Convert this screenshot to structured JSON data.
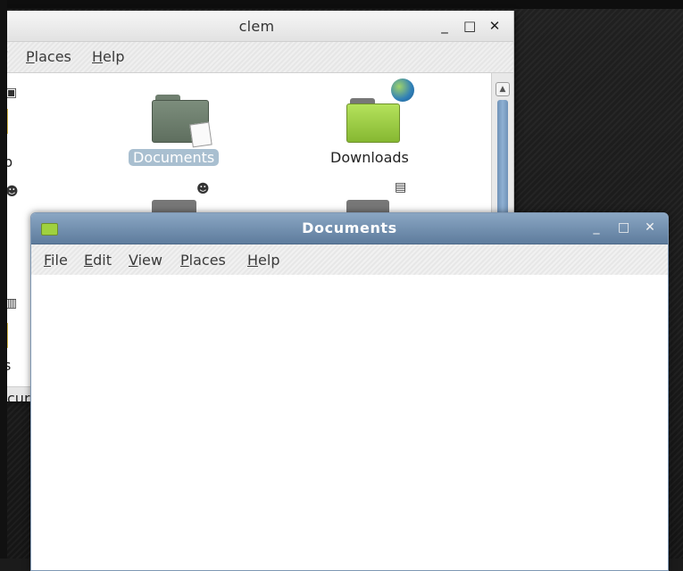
{
  "clem_window": {
    "title": "clem",
    "controls": {
      "minimize": "_",
      "maximize": "□",
      "close": "✕"
    },
    "menu": [
      "/",
      "Places",
      "Help"
    ],
    "icons": [
      {
        "label": "p"
      },
      {
        "label": "Documents",
        "selected": true
      },
      {
        "label": "Downloads"
      },
      {
        "label": "s"
      }
    ],
    "status_partial": "cur"
  },
  "documents_window": {
    "title": "Documents",
    "controls": {
      "minimize": "_",
      "maximize": "□",
      "close": "✕"
    },
    "menu": [
      "File",
      "Edit",
      "View",
      "Places",
      "Help"
    ]
  },
  "colors": {
    "docs_titlebar": "#6f8cab",
    "selection": "#a9bfd0",
    "downloads_folder": "#9fd13f"
  }
}
